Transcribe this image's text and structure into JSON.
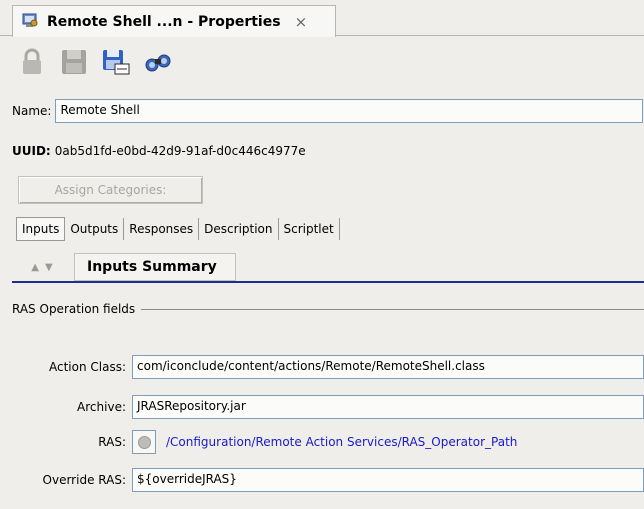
{
  "tab": {
    "title": "Remote Shell ...n - Properties",
    "close": "×"
  },
  "toolbar": {
    "icons": [
      "lock-icon",
      "save-icon",
      "save-as-icon",
      "binoculars-icon"
    ]
  },
  "name": {
    "label": "Name:",
    "value": "Remote Shell"
  },
  "uuid": {
    "label": "UUID:",
    "value": "0ab5d1fd-e0bd-42d9-91af-d0c446c4977e"
  },
  "assign_categories": "Assign Categories:",
  "subtabs": [
    "Inputs",
    "Outputs",
    "Responses",
    "Description",
    "Scriptlet"
  ],
  "summary": {
    "title": "Inputs Summary"
  },
  "group": {
    "title": "RAS Operation fields"
  },
  "fields": {
    "action_class": {
      "label": "Action Class:",
      "value": "com/iconclude/content/actions/Remote/RemoteShell.class"
    },
    "archive": {
      "label": "Archive:",
      "value": "JRASRepository.jar"
    },
    "ras": {
      "label": "RAS:",
      "value": "/Configuration/Remote Action Services/RAS_Operator_Path"
    },
    "override_ras": {
      "label": "Override RAS:",
      "value": "${overrideJRAS}"
    }
  },
  "colors": {
    "accent": "#1d2e8f",
    "link": "#1a1ac8"
  }
}
